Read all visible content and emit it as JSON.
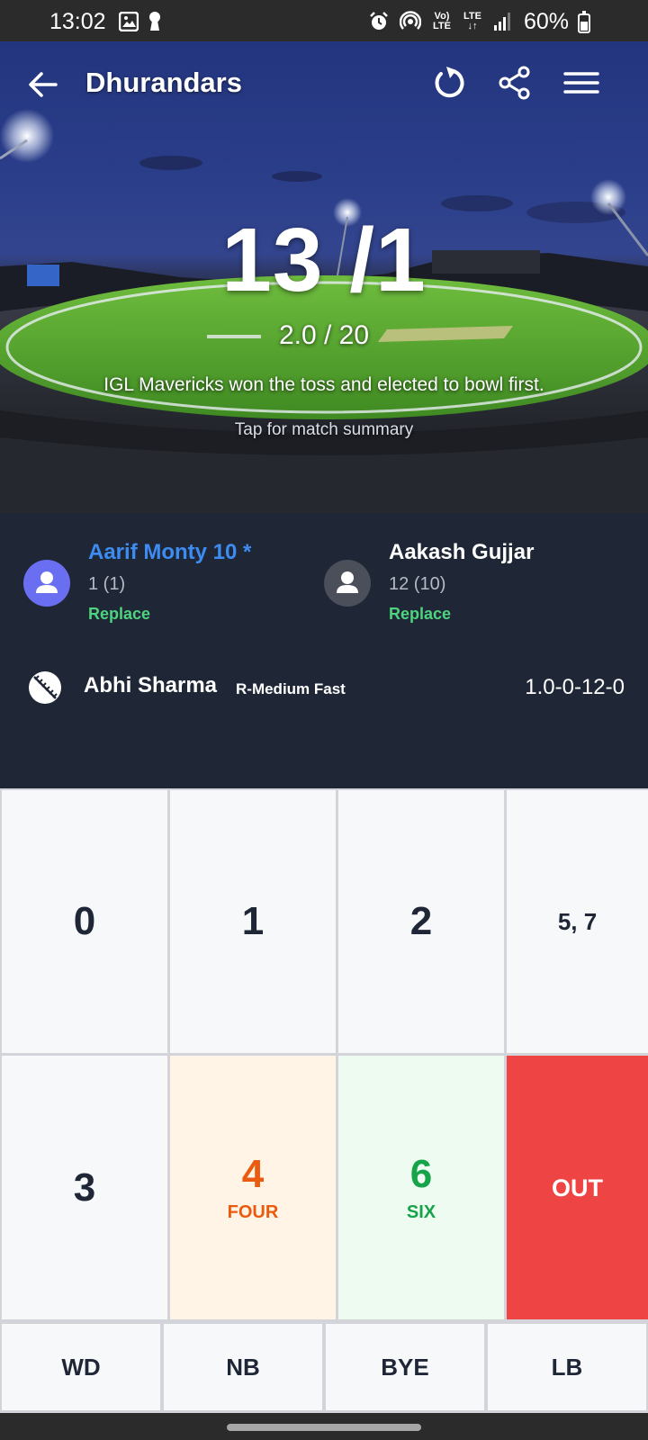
{
  "status_bar": {
    "time": "13:02",
    "battery": "60%",
    "volte_label": "Vo) LTE",
    "lte_label": "LTE"
  },
  "app_bar": {
    "title": "Dhurandars"
  },
  "scoreboard": {
    "score": "13 /1",
    "overs": "2.0 / 20",
    "toss_result": "IGL Mavericks won the toss and elected to bowl first.",
    "summary_link": "Tap for match summary"
  },
  "batters": [
    {
      "name": "Aarif Monty 10 *",
      "stats": "1 (1)",
      "action": "Replace",
      "on_strike": true
    },
    {
      "name": "Aakash Gujjar",
      "stats": "12 (10)",
      "action": "Replace",
      "on_strike": false
    }
  ],
  "bowler": {
    "name": "Abhi Sharma",
    "style": "R-Medium Fast",
    "figures": "1.0-0-12-0"
  },
  "keypad": {
    "run_0": "0",
    "run_1": "1",
    "run_2": "2",
    "run_other": "5, 7",
    "run_3": "3",
    "run_4": "4",
    "run_4_label": "FOUR",
    "run_6": "6",
    "run_6_label": "SIX",
    "out": "OUT"
  },
  "extras": {
    "wide": "WD",
    "no_ball": "NB",
    "bye": "BYE",
    "leg_bye": "LB"
  },
  "colors": {
    "panel_bg": "#1f2737",
    "striker_name": "#3d8cf2",
    "replace_link": "#4ed37e",
    "four": "#ea5b10",
    "six": "#17a34a",
    "out": "#ef4444"
  }
}
